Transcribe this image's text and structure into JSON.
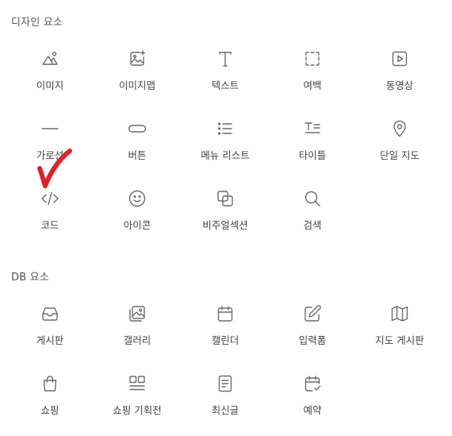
{
  "sections": {
    "design": {
      "title": "디자인 요소",
      "items": [
        {
          "label": "이미지",
          "icon": "image-icon"
        },
        {
          "label": "이미지맵",
          "icon": "image-add-icon"
        },
        {
          "label": "텍스트",
          "icon": "text-icon"
        },
        {
          "label": "여백",
          "icon": "spacing-icon"
        },
        {
          "label": "동영상",
          "icon": "video-icon"
        },
        {
          "label": "가로선",
          "icon": "horizontal-line-icon"
        },
        {
          "label": "버튼",
          "icon": "button-icon"
        },
        {
          "label": "메뉴 리스트",
          "icon": "menu-list-icon"
        },
        {
          "label": "타이틀",
          "icon": "title-icon"
        },
        {
          "label": "단일 지도",
          "icon": "map-pin-icon"
        },
        {
          "label": "코드",
          "icon": "code-icon"
        },
        {
          "label": "아이콘",
          "icon": "smiley-icon"
        },
        {
          "label": "비주얼섹션",
          "icon": "visual-section-icon"
        },
        {
          "label": "검색",
          "icon": "search-icon"
        }
      ]
    },
    "db": {
      "title": "DB 요소",
      "items": [
        {
          "label": "게시판",
          "icon": "inbox-icon"
        },
        {
          "label": "갤러리",
          "icon": "gallery-icon"
        },
        {
          "label": "캘린더",
          "icon": "calendar-icon"
        },
        {
          "label": "입력폼",
          "icon": "edit-form-icon"
        },
        {
          "label": "지도 게시판",
          "icon": "map-icon"
        },
        {
          "label": "쇼핑",
          "icon": "shopping-bag-icon"
        },
        {
          "label": "쇼핑 기획전",
          "icon": "shopping-layout-icon"
        },
        {
          "label": "최신글",
          "icon": "document-icon"
        },
        {
          "label": "예약",
          "icon": "calendar-check-icon"
        }
      ]
    }
  },
  "annotation": {
    "icon": "red-checkmark-icon",
    "color": "#e0202a"
  },
  "colors": {
    "icon_stroke": "#6b6b6b",
    "label": "#444444",
    "section_title": "#555555"
  }
}
